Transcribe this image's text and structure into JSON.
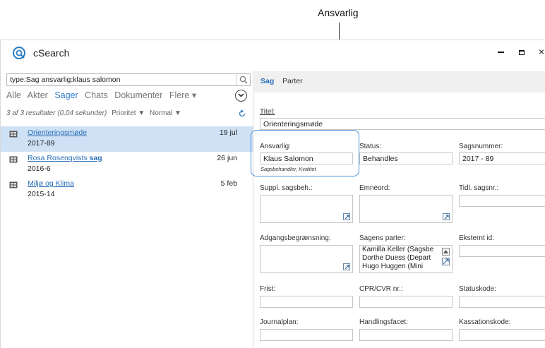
{
  "callout": {
    "label": "Ansvarlig"
  },
  "window": {
    "title": "cSearch",
    "controls": {
      "minimize": "minimize-icon",
      "maximize": "maximize-icon",
      "close": "×"
    }
  },
  "search": {
    "query": "type:Sag ansvarlig:klaus salomon",
    "filters": [
      "Alle",
      "Akter",
      "Sager",
      "Chats",
      "Dokumenter",
      "Flere ▾"
    ],
    "active_filter": "Sager"
  },
  "results": {
    "count_text": "3 af 3 resultater (0,04 sekunder)",
    "sort1": "Prioritet ▼",
    "sort2": "Normal ▼",
    "items": [
      {
        "title": "Orienteringsmøde",
        "title_bold": "",
        "number": "2017-89",
        "date": "19 jul",
        "selected": true
      },
      {
        "title": "Rosa Rosenqvists ",
        "title_bold": "sag",
        "number": "2016-6",
        "date": "26 jun",
        "selected": false
      },
      {
        "title": "Miljø og Klima",
        "title_bold": "",
        "number": "2015-14",
        "date": "5 feb",
        "selected": false
      }
    ]
  },
  "detail": {
    "tabs": {
      "sag": "Sag",
      "parter": "Parter"
    },
    "titel_label": "Titel:",
    "titel_value": "Orienteringsmøde",
    "ansvarlig_label": "Ansvarlig:",
    "ansvarlig_value": "Klaus Salomon",
    "ansvarlig_note": "Sagsbehandler, Kvalitet",
    "status_label": "Status:",
    "status_value": "Behandles",
    "sagsnummer_label": "Sagsnummer:",
    "sagsnummer_value": "2017 - 89",
    "suppl_label": "Suppl. sagsbeh.:",
    "emneord_label": "Emneord:",
    "tidl_label": "Tidl. sagsnr.:",
    "adgang_label": "Adgangsbegrænsning:",
    "parter_label": "Sagens parter:",
    "eksternt_label": "Eksternt id:",
    "parter": [
      "Kamilla Keller (Sagsbe",
      "Dorthe Duess (Depart",
      "Hugo Huggen (Mini"
    ],
    "frist_label": "Frist:",
    "cpr_label": "CPR/CVR nr.:",
    "statuskode_label": "Statuskode:",
    "journalplan_label": "Journalplan:",
    "handlingsfacet_label": "Handlingsfacet:",
    "kassation_label": "Kassationskode:"
  },
  "colors": {
    "accent": "#2a7cc7",
    "selected_row": "#cfe1f4",
    "highlight": "#4a90d9"
  }
}
